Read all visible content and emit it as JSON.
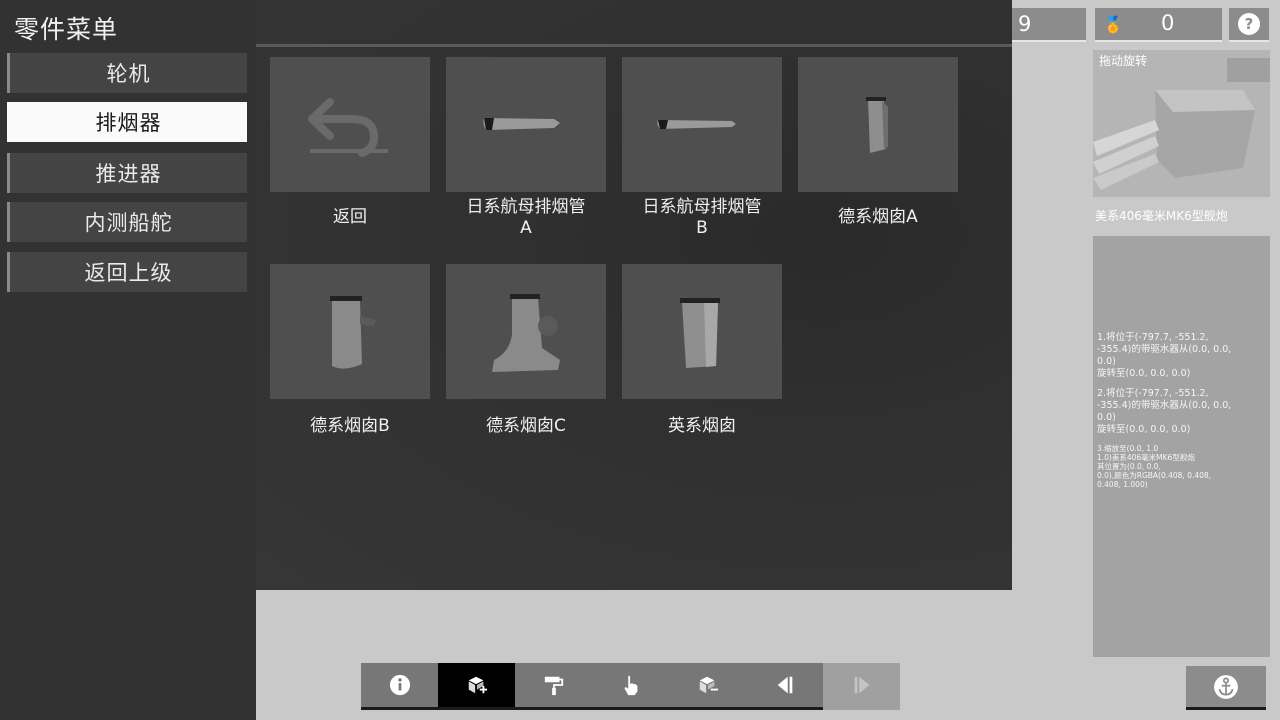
{
  "sidebar": {
    "title": "零件菜单",
    "items": [
      {
        "label": "轮机",
        "active": false
      },
      {
        "label": "排烟器",
        "active": true
      },
      {
        "label": "推进器",
        "active": false
      },
      {
        "label": "内测船舵",
        "active": false
      },
      {
        "label": "返回上级",
        "active": false
      }
    ]
  },
  "parts": [
    {
      "label": "返回",
      "icon": "back-arrow-icon"
    },
    {
      "label": "日系航母排烟管A",
      "icon": "japanese-carrier-exhaust-a"
    },
    {
      "label": "日系航母排烟管B",
      "icon": "japanese-carrier-exhaust-b"
    },
    {
      "label": "德系烟囱A",
      "icon": "german-funnel-a"
    },
    {
      "label": "德系烟囱B",
      "icon": "german-funnel-b"
    },
    {
      "label": "德系烟囱C",
      "icon": "german-funnel-c"
    },
    {
      "label": "英系烟囱",
      "icon": "british-funnel"
    }
  ],
  "counters": {
    "left_value": "9",
    "medal_value": "0",
    "medal_icon": "medal-icon",
    "help_icon": "help-icon",
    "help_symbol": "?"
  },
  "preview": {
    "label": "拖动旋转",
    "part_name": "美系406毫米MK6型舰炮"
  },
  "info": {
    "block1": "1.将位于(-797.7, -551.2,\n-355.4)的带驱水器从(0.0, 0.0,\n0.0)\n旋转至(0.0, 0.0, 0.0)",
    "block2": "2.将位于(-797.7, -551.2,\n-355.4)的带驱水器从(0.0, 0.0,\n0.0)\n旋转至(0.0, 0.0, 0.0)",
    "block3": "3.缩放至(0.0, 1.0\n1.0)美系406毫米MK6型舰炮\n其位置为(0.0, 0.0,\n0.0),颜色为RGBA(0.408, 0.408,\n0.408, 1.000)"
  },
  "toolbar": {
    "buttons": [
      {
        "icon": "info-icon",
        "state": "normal"
      },
      {
        "icon": "add-part-icon",
        "state": "active"
      },
      {
        "icon": "paint-roller-icon",
        "state": "normal"
      },
      {
        "icon": "hand-pointer-icon",
        "state": "normal"
      },
      {
        "icon": "remove-part-icon",
        "state": "normal"
      },
      {
        "icon": "undo-step-icon",
        "state": "normal"
      },
      {
        "icon": "redo-step-icon",
        "state": "disabled"
      }
    ],
    "anchor_icon": "anchor-icon"
  },
  "colors": {
    "sidebar_bg": "#323232",
    "panel_bg": "#363636",
    "tile_bg": "#4f4f4f",
    "active_item": "#fafafa",
    "toolbar_active": "#000000"
  }
}
